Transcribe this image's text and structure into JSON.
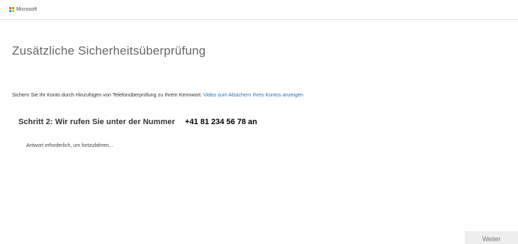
{
  "brand": {
    "name": "Microsoft",
    "colors": [
      "#f25022",
      "#7fba00",
      "#00a4ef",
      "#ffb900"
    ]
  },
  "page": {
    "title": "Zusätzliche Sicherheitsüberprüfung",
    "info_text": "Sichern Sie Ihr Konto durch Hinzufügen von Telefonüberprüfung zu Ihrem Kennwort.",
    "info_link": "Video zum Absichern Ihres Kontos anzeigen",
    "step_label": "Schritt 2: Wir rufen Sie unter der Nummer",
    "step_number": "+41 81 234 56 78 an",
    "wait_text": "Antwort erforderlich, um fortzufahren...",
    "next_label": "Weiter"
  }
}
